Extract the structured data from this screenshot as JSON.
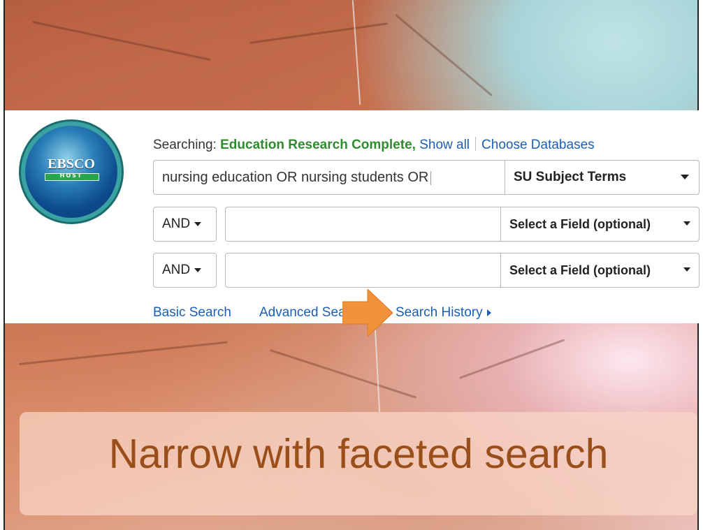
{
  "searching": {
    "prefix": "Searching: ",
    "database": "Education Research Complete,",
    "show_all": "Show all",
    "choose_databases": "Choose Databases"
  },
  "logo": {
    "title": "EBSCO",
    "subtitle": "HOST"
  },
  "rows": [
    {
      "query": "nursing education OR nursing students OR",
      "field": "SU Subject Terms"
    },
    {
      "operator": "AND",
      "query": "",
      "field": "Select a Field (optional)"
    },
    {
      "operator": "AND",
      "query": "",
      "field": "Select a Field (optional)"
    }
  ],
  "links": {
    "basic_search": "Basic Search",
    "advanced_search": "Advanced Search",
    "search_history": "Search History"
  },
  "banner": {
    "text": "Narrow with faceted search"
  },
  "colors": {
    "link": "#1a5fb4",
    "database": "#2e8b2e",
    "arrow": "#f0923a",
    "banner_text": "#9a4e1a"
  },
  "icons": {
    "logo": "ebsco-host-logo-icon",
    "arrow": "orange-arrow-icon",
    "history_arrow": "triangle-right-icon"
  }
}
